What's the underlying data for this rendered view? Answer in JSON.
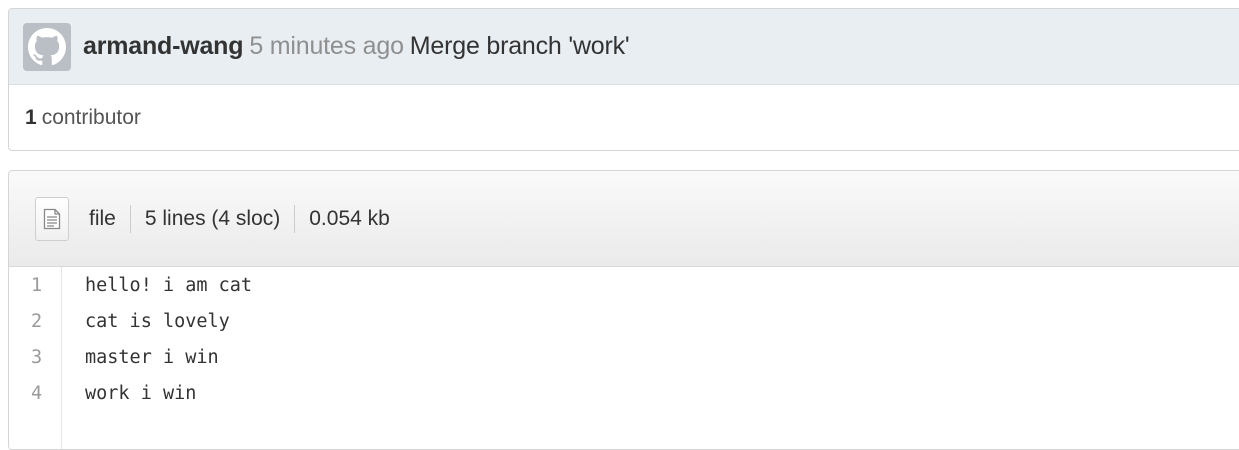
{
  "commit": {
    "author": "armand-wang",
    "time_ago": "5 minutes ago",
    "message": "Merge branch 'work'",
    "avatar_icon": "github-octocat-icon"
  },
  "contributors": {
    "count": "1",
    "label": "contributor"
  },
  "file": {
    "icon": "file-text-icon",
    "name": "file",
    "lines_info": "5 lines (4 sloc)",
    "size": "0.054 kb",
    "lines": [
      {
        "num": "1",
        "text": "hello! i am cat"
      },
      {
        "num": "2",
        "text": "cat is lovely"
      },
      {
        "num": "3",
        "text": "master i win"
      },
      {
        "num": "4",
        "text": "work i win"
      }
    ]
  }
}
